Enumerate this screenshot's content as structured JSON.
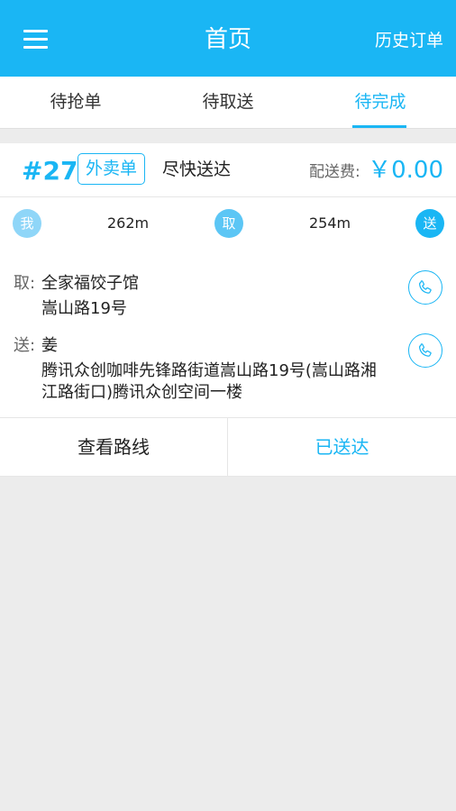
{
  "header": {
    "title": "首页",
    "history_label": "历史订单"
  },
  "tabs": [
    {
      "label": "待抢单"
    },
    {
      "label": "待取送"
    },
    {
      "label": "待完成",
      "active": true
    }
  ],
  "order": {
    "number": "#27",
    "tag": "外卖单",
    "urgency": "尽快送达",
    "fee_label": "配送费:",
    "fee_value": "￥0.00",
    "route": {
      "me_label": "我",
      "pick_label": "取",
      "drop_label": "送",
      "dist_to_pickup": "262m",
      "dist_to_dropoff": "254m"
    },
    "pickup": {
      "label": "取:",
      "name": "全家福饺子馆",
      "address": "嵩山路19号"
    },
    "dropoff": {
      "label": "送:",
      "name": "姜",
      "address_line1": "腾讯众创咖啡先锋路街道嵩山路19号(嵩山路湘",
      "address_line2": "江路街口)腾讯众创空间一楼"
    },
    "actions": {
      "route_label": "查看路线",
      "delivered_label": "已送达"
    }
  },
  "colors": {
    "accent": "#1ab6f4",
    "background": "#ececec"
  }
}
